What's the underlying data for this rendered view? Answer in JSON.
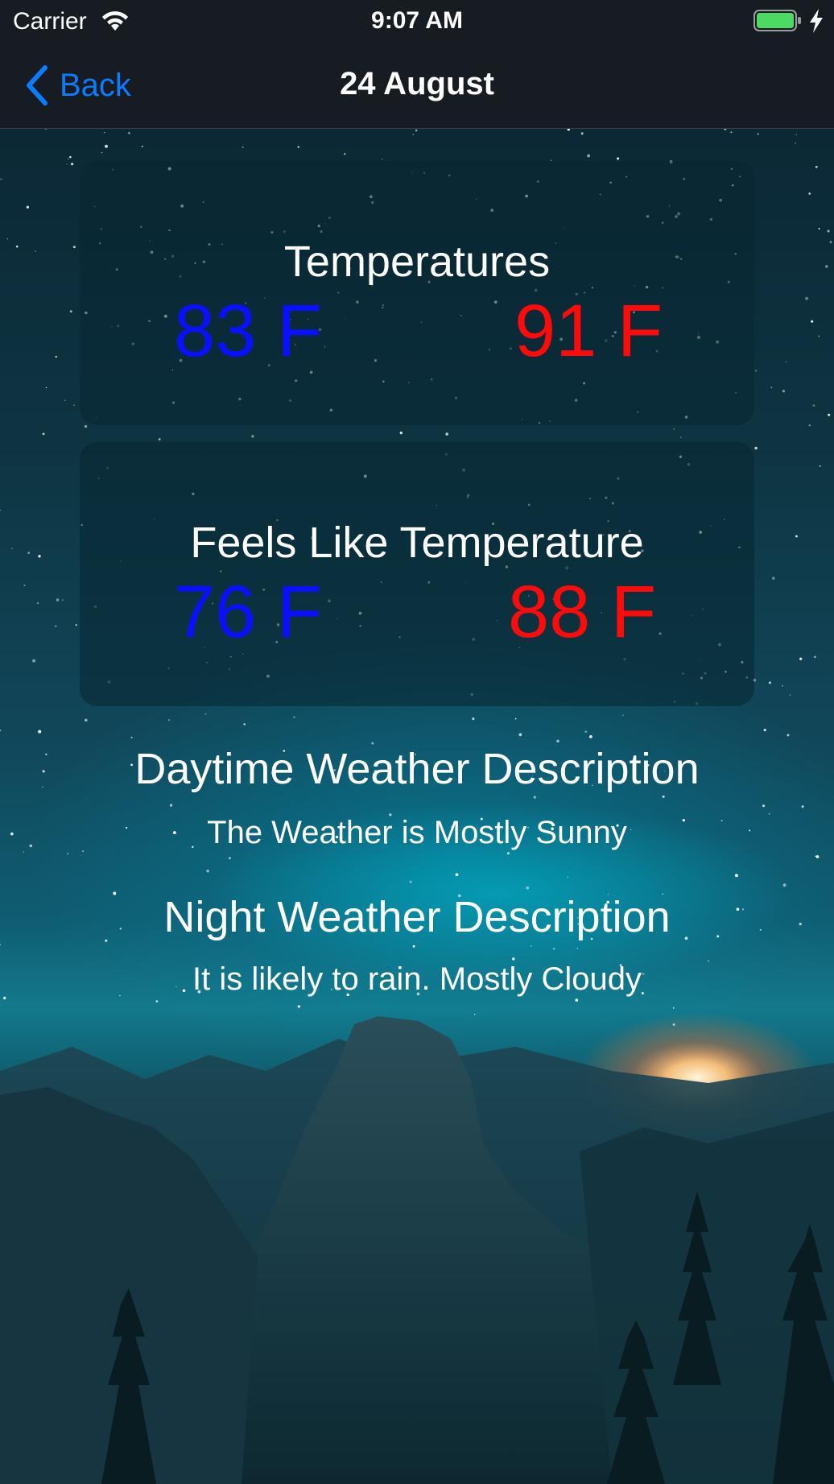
{
  "status_bar": {
    "carrier": "Carrier",
    "time": "9:07 AM",
    "icons": [
      "wifi-icon",
      "battery-icon",
      "charging-icon"
    ]
  },
  "nav": {
    "back_label": "Back",
    "title": "24 August",
    "accent_color": "#0a7cff"
  },
  "temperatures": {
    "title": "Temperatures",
    "low": "83 F",
    "high": "91 F"
  },
  "feels_like": {
    "title": "Feels Like Temperature",
    "low": "76 F",
    "high": "88 F"
  },
  "daytime": {
    "heading": "Daytime Weather Description",
    "text": "The Weather is Mostly Sunny"
  },
  "night": {
    "heading": "Night Weather Description",
    "text": "It is likely to rain. Mostly Cloudy"
  },
  "colors": {
    "low_temp": "#0a10ff",
    "high_temp": "#ff0a0a",
    "bar_background": "#171c22"
  }
}
